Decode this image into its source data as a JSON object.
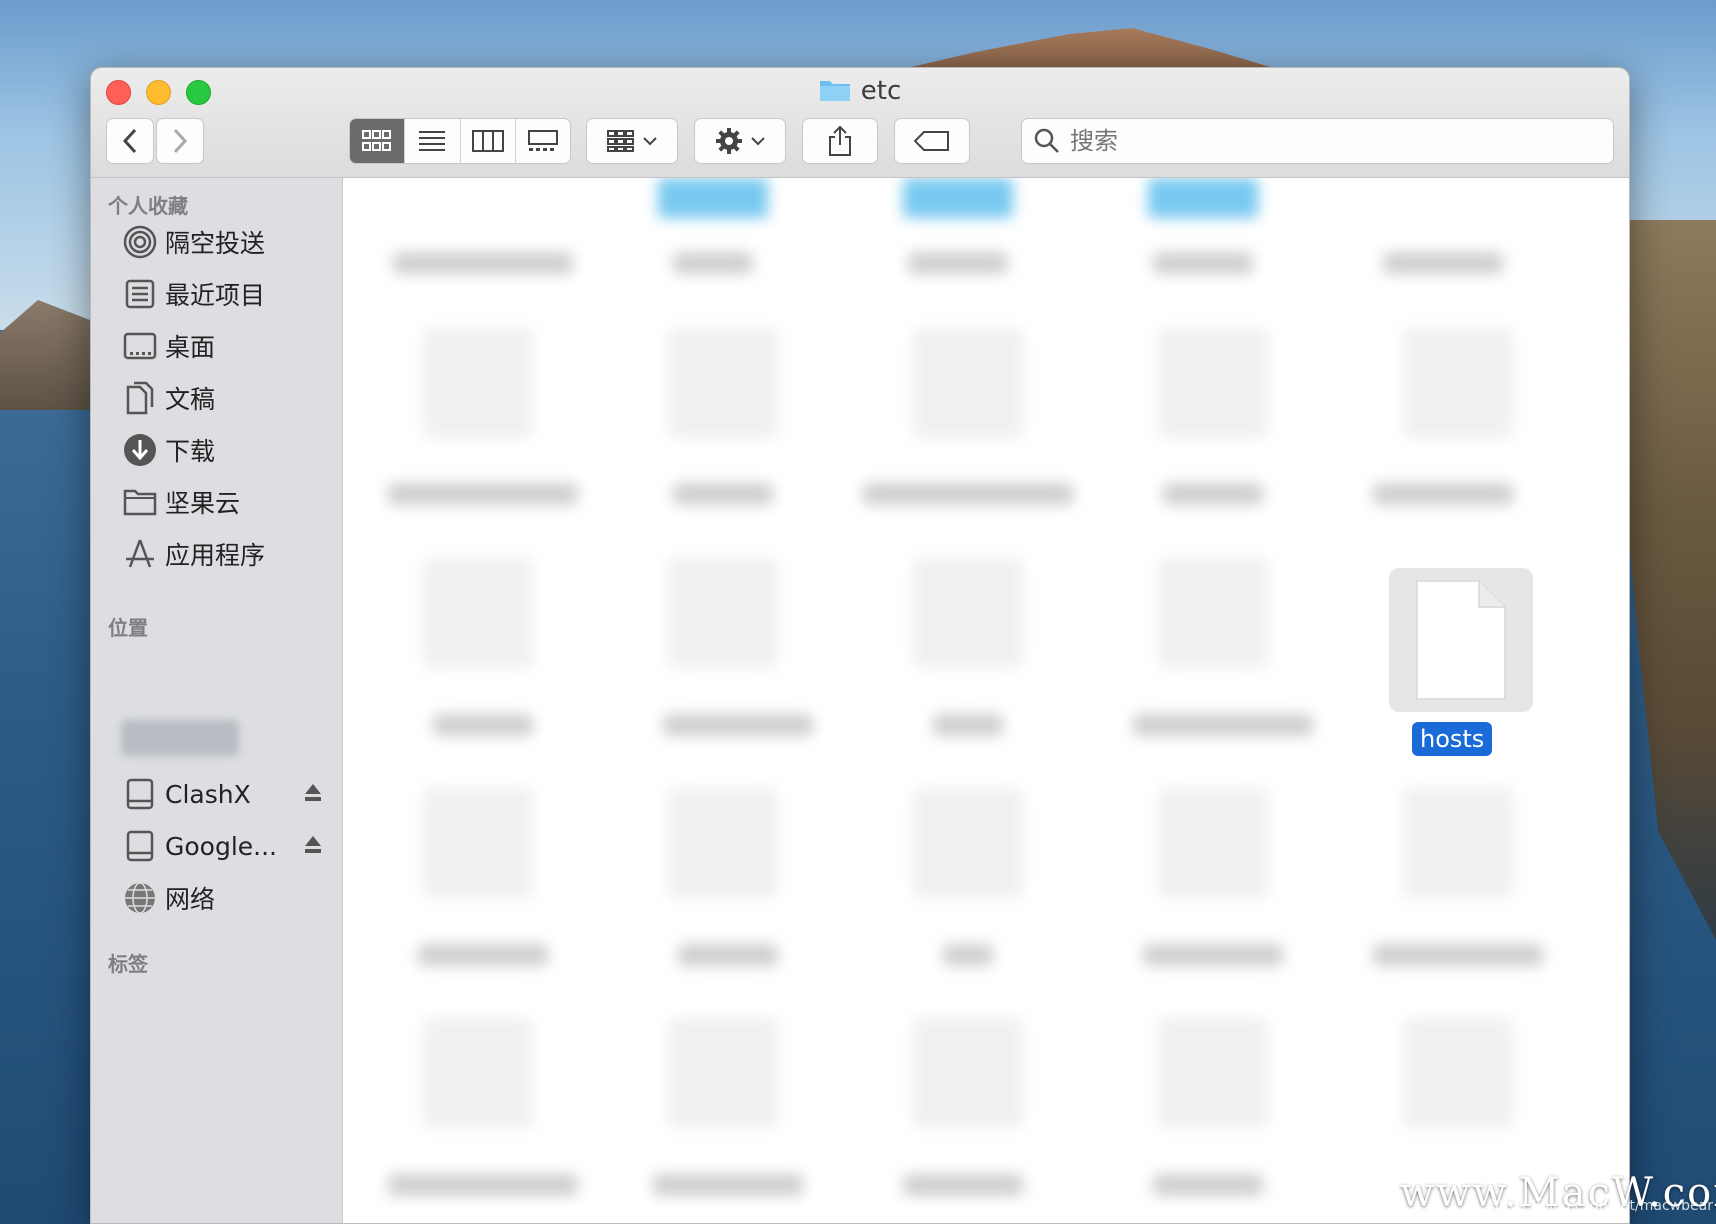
{
  "window": {
    "title": "etc"
  },
  "toolbar": {
    "search_placeholder": "搜索"
  },
  "sidebar": {
    "favorites_header": "个人收藏",
    "favorites": [
      {
        "label": "隔空投送",
        "icon": "airdrop-icon"
      },
      {
        "label": "最近项目",
        "icon": "recents-icon"
      },
      {
        "label": "桌面",
        "icon": "desktop-icon"
      },
      {
        "label": "文稿",
        "icon": "documents-icon"
      },
      {
        "label": "下载",
        "icon": "downloads-icon"
      },
      {
        "label": "坚果云",
        "icon": "folder-icon"
      },
      {
        "label": "应用程序",
        "icon": "applications-icon"
      }
    ],
    "locations_header": "位置",
    "locations": [
      {
        "label": "ClashX",
        "icon": "drive-icon",
        "eject": true
      },
      {
        "label": "Google...",
        "icon": "drive-icon",
        "eject": true
      },
      {
        "label": "网络",
        "icon": "network-icon",
        "eject": false
      }
    ],
    "tags_header": "标签"
  },
  "files": {
    "selected_item": "hosts"
  },
  "watermark": {
    "brand": "www.MacW.com",
    "url": "https://blog.csdn.net/macwbear"
  },
  "colors": {
    "selection": "#1a6bd7",
    "sidebar_bg": "#dcdee2"
  }
}
